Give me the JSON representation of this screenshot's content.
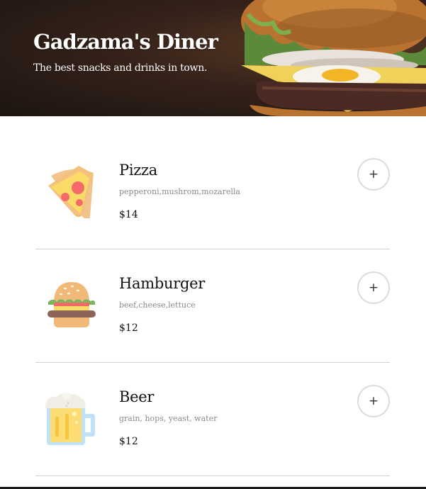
{
  "header": {
    "title": "Gadzama's Diner",
    "subtitle": "The best snacks and drinks in town."
  },
  "menu": {
    "items": [
      {
        "name": "Pizza",
        "description": "pepperoni,mushrom,mozarella",
        "price": "$14",
        "add_label": "+",
        "icon": "pizza-icon"
      },
      {
        "name": "Hamburger",
        "description": "beef,cheese,lettuce",
        "price": "$12",
        "add_label": "+",
        "icon": "hamburger-icon"
      },
      {
        "name": "Beer",
        "description": "grain, hops, yeast, water",
        "price": "$12",
        "add_label": "+",
        "icon": "beer-icon"
      }
    ]
  }
}
